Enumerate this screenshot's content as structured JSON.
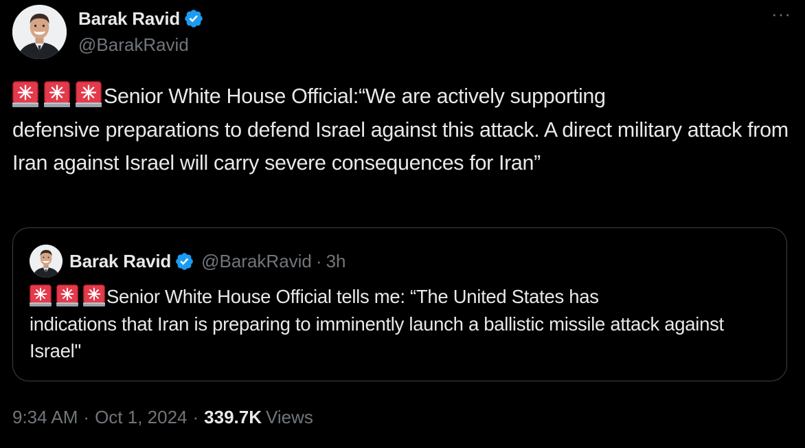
{
  "author": {
    "name": "Barak Ravid",
    "handle": "@BarakRavid",
    "verified": true
  },
  "more_menu": "···",
  "tweet": {
    "emoji_icon": "police-car-light-icon",
    "text_line1": "Senior White House Official:“We are actively supporting",
    "text_rest": "defensive preparations to defend Israel against this attack. A direct military attack from Iran against Israel will carry severe consequences for Iran”"
  },
  "quote": {
    "name": "Barak Ravid",
    "handle": "@BarakRavid",
    "separator": "·",
    "time": "3h",
    "text_line1": "Senior White House Official tells me: “The United States has",
    "text_rest": "indications that Iran is preparing to imminently launch a ballistic missile attack against Israel\""
  },
  "meta": {
    "time": "9:34 AM",
    "date": "Oct 1, 2024",
    "separator": "·",
    "views_count": "339.7K",
    "views_label": "Views"
  },
  "colors": {
    "background": "#000000",
    "text": "#e7e9ea",
    "secondary": "#71767b",
    "verified": "#1d9bf0",
    "border": "#3e4144",
    "siren_red": "#d7263d"
  }
}
